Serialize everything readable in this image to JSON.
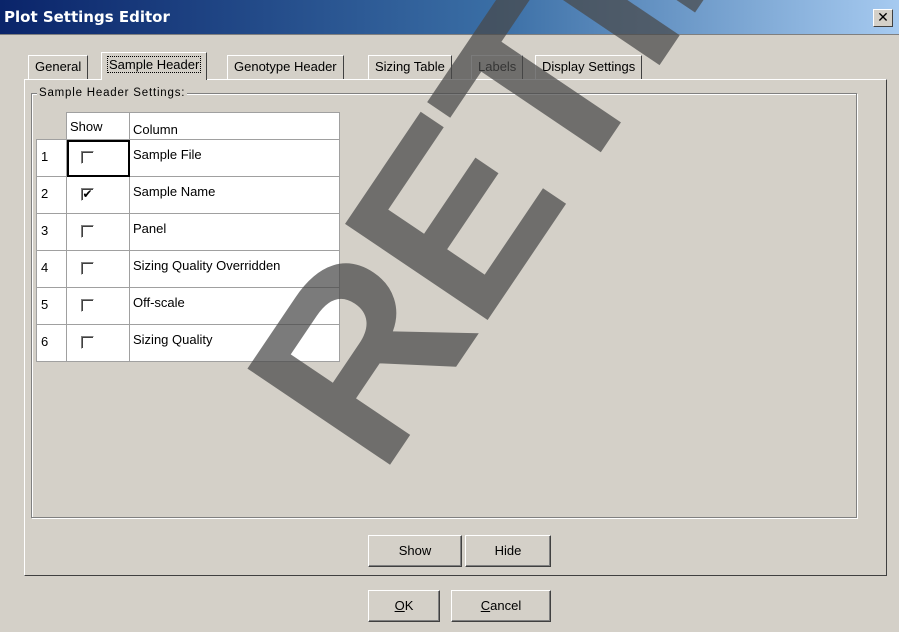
{
  "window": {
    "title": "Plot Settings Editor",
    "close_glyph": "✕"
  },
  "tabs": [
    {
      "label": "General"
    },
    {
      "label": "Sample Header"
    },
    {
      "label": "Genotype Header"
    },
    {
      "label": "Sizing Table"
    },
    {
      "label": "Labels"
    },
    {
      "label": "Display Settings"
    }
  ],
  "active_tab": "Sample Header",
  "group": {
    "legend": "Sample Header Settings:"
  },
  "table": {
    "headers": [
      "",
      "Show",
      "Column"
    ],
    "rows": [
      {
        "num": "1",
        "show": false,
        "column": "Sample File"
      },
      {
        "num": "2",
        "show": true,
        "column": "Sample Name"
      },
      {
        "num": "3",
        "show": false,
        "column": "Panel"
      },
      {
        "num": "4",
        "show": false,
        "column": "Sizing Quality Overridden"
      },
      {
        "num": "5",
        "show": false,
        "column": "Off-scale"
      },
      {
        "num": "6",
        "show": false,
        "column": "Sizing Quality"
      }
    ]
  },
  "buttons": {
    "show": "Show",
    "hide": "Hide",
    "ok_mnemonic": "O",
    "ok_rest": "K",
    "cancel_mnemonic": "C",
    "cancel_rest": "ancel"
  },
  "watermark": {
    "text": "RETIRED",
    "color": "#484848"
  },
  "check_glyph": "✔"
}
